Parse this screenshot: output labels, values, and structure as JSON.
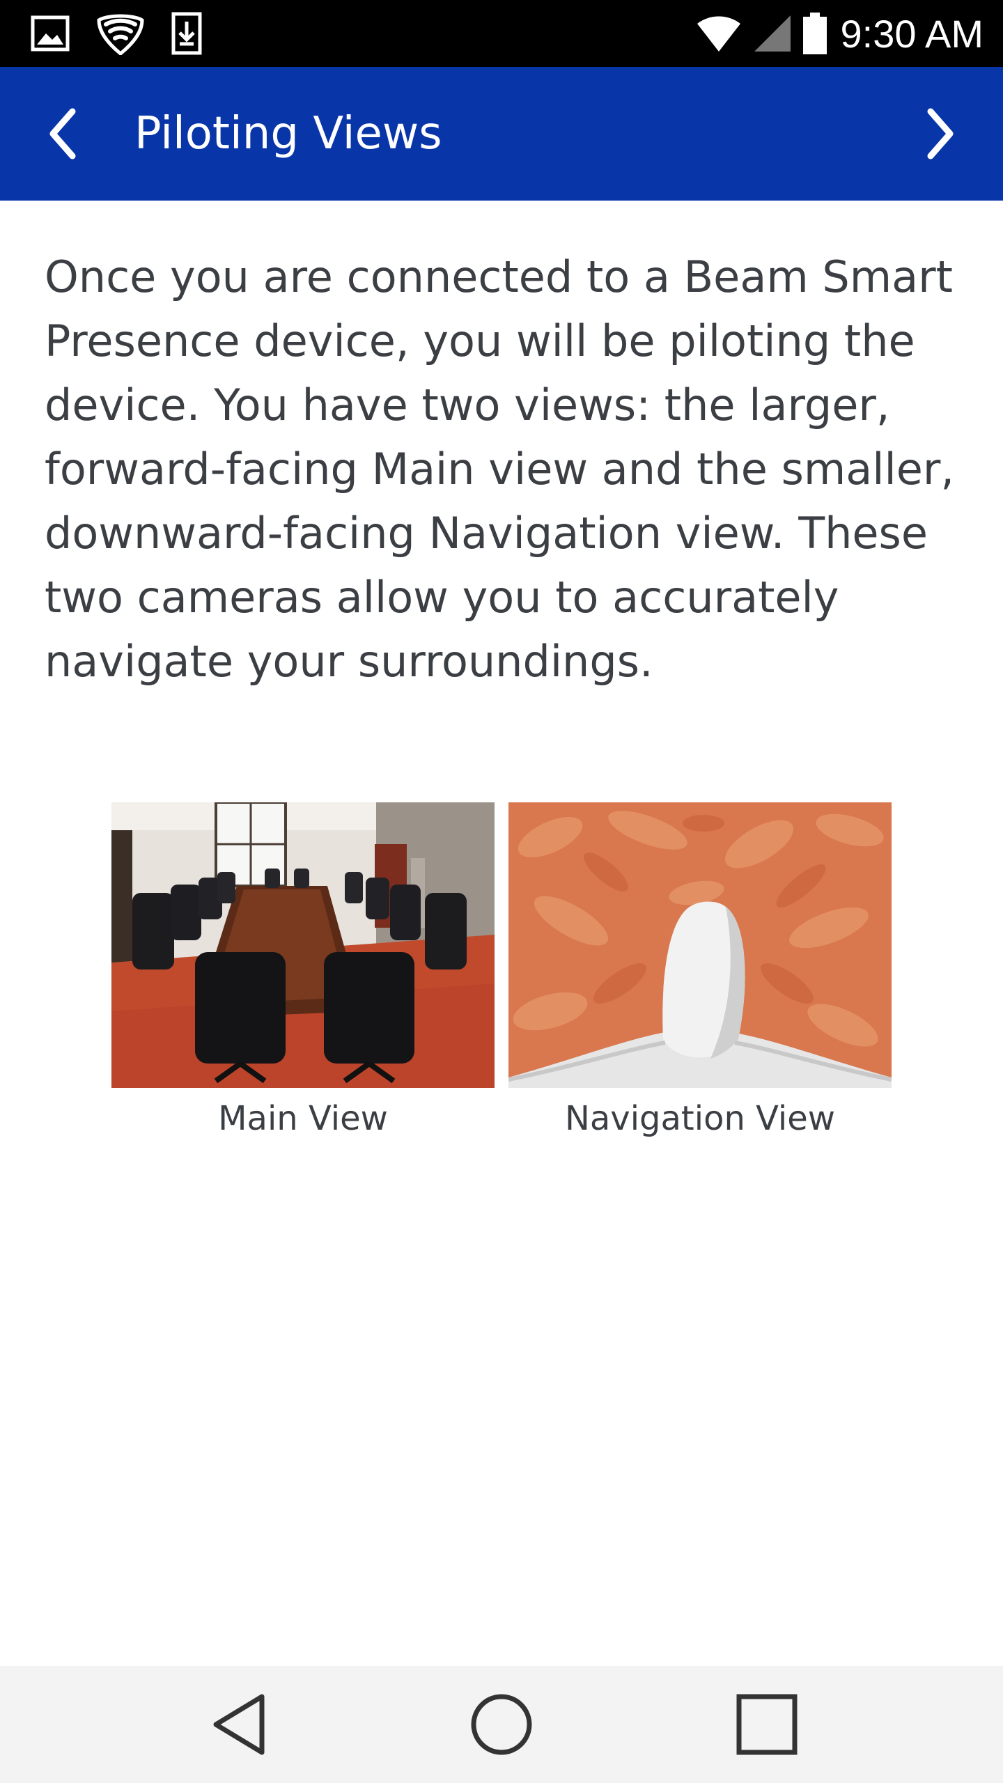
{
  "status_bar": {
    "time": "9:30 AM",
    "left_icons": [
      "image-notification-icon",
      "security-shield-icon",
      "download-notification-icon"
    ],
    "right_icons": [
      "wifi-icon",
      "cell-signal-icon",
      "battery-icon"
    ]
  },
  "app_bar": {
    "title": "Piloting Views",
    "back_icon": "chevron-left-icon",
    "next_icon": "chevron-right-icon",
    "background_color": "#0835a8"
  },
  "content": {
    "intro_text": "Once you are connected to a Beam Smart Presence device, you will be piloting the device. You have two views: the larger, forward-facing Main view and the smaller, downward-facing Navigation view. These two cameras allow you to accurately navigate your surroundings.",
    "views": [
      {
        "caption": "Main View",
        "image": "conference-room-image"
      },
      {
        "caption": "Navigation View",
        "image": "carpet-floor-robot-base-image"
      }
    ]
  },
  "nav_bar": {
    "buttons": [
      "back-triangle-icon",
      "home-circle-icon",
      "recents-square-icon"
    ]
  },
  "colors": {
    "app_bar": "#0835a8",
    "text": "#3b3f44",
    "status_bar": "#000000",
    "nav_bar": "#f3f3f3"
  }
}
